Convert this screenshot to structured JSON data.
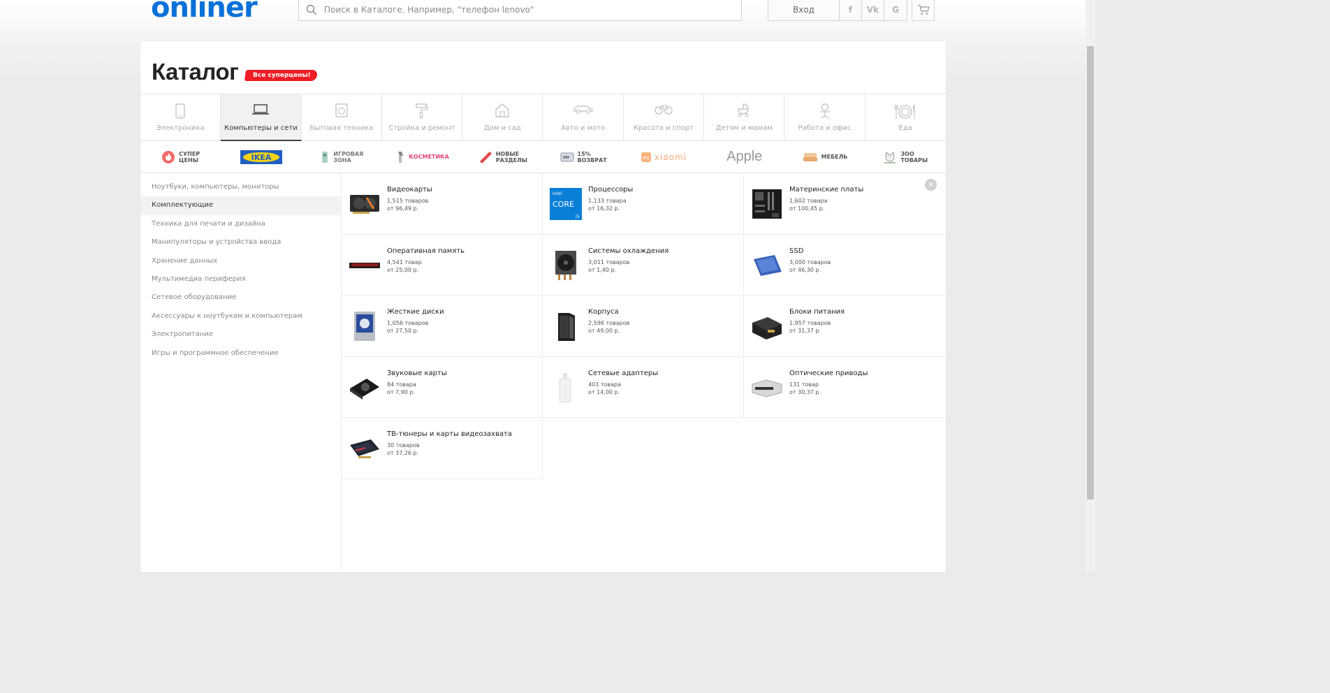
{
  "header": {
    "logo": "onliner",
    "search_placeholder": "Поиск в Каталоге. Например, \"телефон lenovo\"",
    "login": "Вход",
    "social": [
      "f",
      "Vk",
      "G"
    ]
  },
  "page": {
    "title": "Каталог",
    "promo_badge": "Все суперцены!"
  },
  "categories": [
    {
      "label": "Электроника",
      "icon": "phone-icon"
    },
    {
      "label": "Компьютеры и сети",
      "icon": "laptop-icon",
      "active": true
    },
    {
      "label": "Бытовая техника",
      "icon": "washing-machine-icon"
    },
    {
      "label": "Стройка и ремонт",
      "icon": "paint-roller-icon"
    },
    {
      "label": "Дом и сад",
      "icon": "house-icon"
    },
    {
      "label": "Авто и мото",
      "icon": "car-icon"
    },
    {
      "label": "Красота и спорт",
      "icon": "bicycle-icon"
    },
    {
      "label": "Детям и мамам",
      "icon": "stroller-icon"
    },
    {
      "label": "Работа и офис",
      "icon": "office-chair-icon"
    },
    {
      "label": "Еда",
      "icon": "plate-icon"
    }
  ],
  "brands": [
    {
      "line1": "СУПЕР",
      "line2": "ЦЕНЫ",
      "icon": "fire-icon"
    },
    {
      "text": "IKEA",
      "icon": "ikea-logo"
    },
    {
      "line1": "ИГРОВАЯ",
      "line2": "ЗОНА",
      "icon": "gamepad-icon"
    },
    {
      "text": "КОСМЕТИКА",
      "icon": "cosmetics-icon"
    },
    {
      "line1": "НОВЫЕ",
      "line2": "РАЗДЕЛЫ",
      "icon": "new-badge-icon"
    },
    {
      "line1": "15%",
      "line2": "ВОЗВРАТ",
      "icon": "return-icon"
    },
    {
      "text": "xiaomi",
      "icon": "xiaomi-logo"
    },
    {
      "text": "Apple",
      "icon": "apple-logo"
    },
    {
      "text": "МЕБЕЛЬ",
      "icon": "sofa-icon"
    },
    {
      "line1": "ЗОО",
      "line2": "ТОВАРЫ",
      "icon": "cat-icon"
    }
  ],
  "left_nav": [
    {
      "label": "Ноутбуки, компьютеры, мониторы"
    },
    {
      "label": "Комплектующие",
      "active": true
    },
    {
      "label": "Техника для печати и дизайна"
    },
    {
      "label": "Манипуляторы и устройства ввода"
    },
    {
      "label": "Хранение данных"
    },
    {
      "label": "Мультимедиа периферия"
    },
    {
      "label": "Сетевое оборудование"
    },
    {
      "label": "Аксессуары к ноутбукам и компьютерам"
    },
    {
      "label": "Электропитание"
    },
    {
      "label": "Игры и программное обеспечение"
    }
  ],
  "items": [
    {
      "name": "Видеокарты",
      "count": "1,515 товаров",
      "price": "от 96,49 р.",
      "icon": "graphics-card-image"
    },
    {
      "name": "Процессоры",
      "count": "1,133 товара",
      "price": "от 16,32 р.",
      "icon": "cpu-image"
    },
    {
      "name": "Материнские платы",
      "count": "1,602 товара",
      "price": "от 100,45 р.",
      "icon": "motherboard-image"
    },
    {
      "name": "Оперативная память",
      "count": "4,541 товар",
      "price": "от 25,00 р.",
      "icon": "ram-image"
    },
    {
      "name": "Системы охлаждения",
      "count": "3,011 товаров",
      "price": "от 1,40 р.",
      "icon": "cooler-image"
    },
    {
      "name": "SSD",
      "count": "3,000 товаров",
      "price": "от 46,30 р.",
      "icon": "ssd-image"
    },
    {
      "name": "Жесткие диски",
      "count": "1,056 товаров",
      "price": "от 27,50 р.",
      "icon": "hdd-image"
    },
    {
      "name": "Корпуса",
      "count": "2,596 товаров",
      "price": "от 49,00 р.",
      "icon": "pc-case-image"
    },
    {
      "name": "Блоки питания",
      "count": "1,957 товаров",
      "price": "от 31,37 р.",
      "icon": "psu-image"
    },
    {
      "name": "Звуковые карты",
      "count": "84 товара",
      "price": "от 7,90 р.",
      "icon": "sound-card-image"
    },
    {
      "name": "Сетевые адаптеры",
      "count": "403 товара",
      "price": "от 14,00 р.",
      "icon": "network-adapter-image"
    },
    {
      "name": "Оптические приводы",
      "count": "131 товар",
      "price": "от 30,37 р.",
      "icon": "optical-drive-image"
    },
    {
      "name": "ТВ-тюнеры и карты видеозахвата",
      "count": "30 товаров",
      "price": "от 37,26 р.",
      "icon": "tv-tuner-image"
    }
  ],
  "cpu_label": {
    "brand": "intel",
    "name": "CORE",
    "tier": "i5"
  },
  "colors": {
    "brand_blue": "#0a71d9",
    "promo_red": "#ee1c25"
  }
}
